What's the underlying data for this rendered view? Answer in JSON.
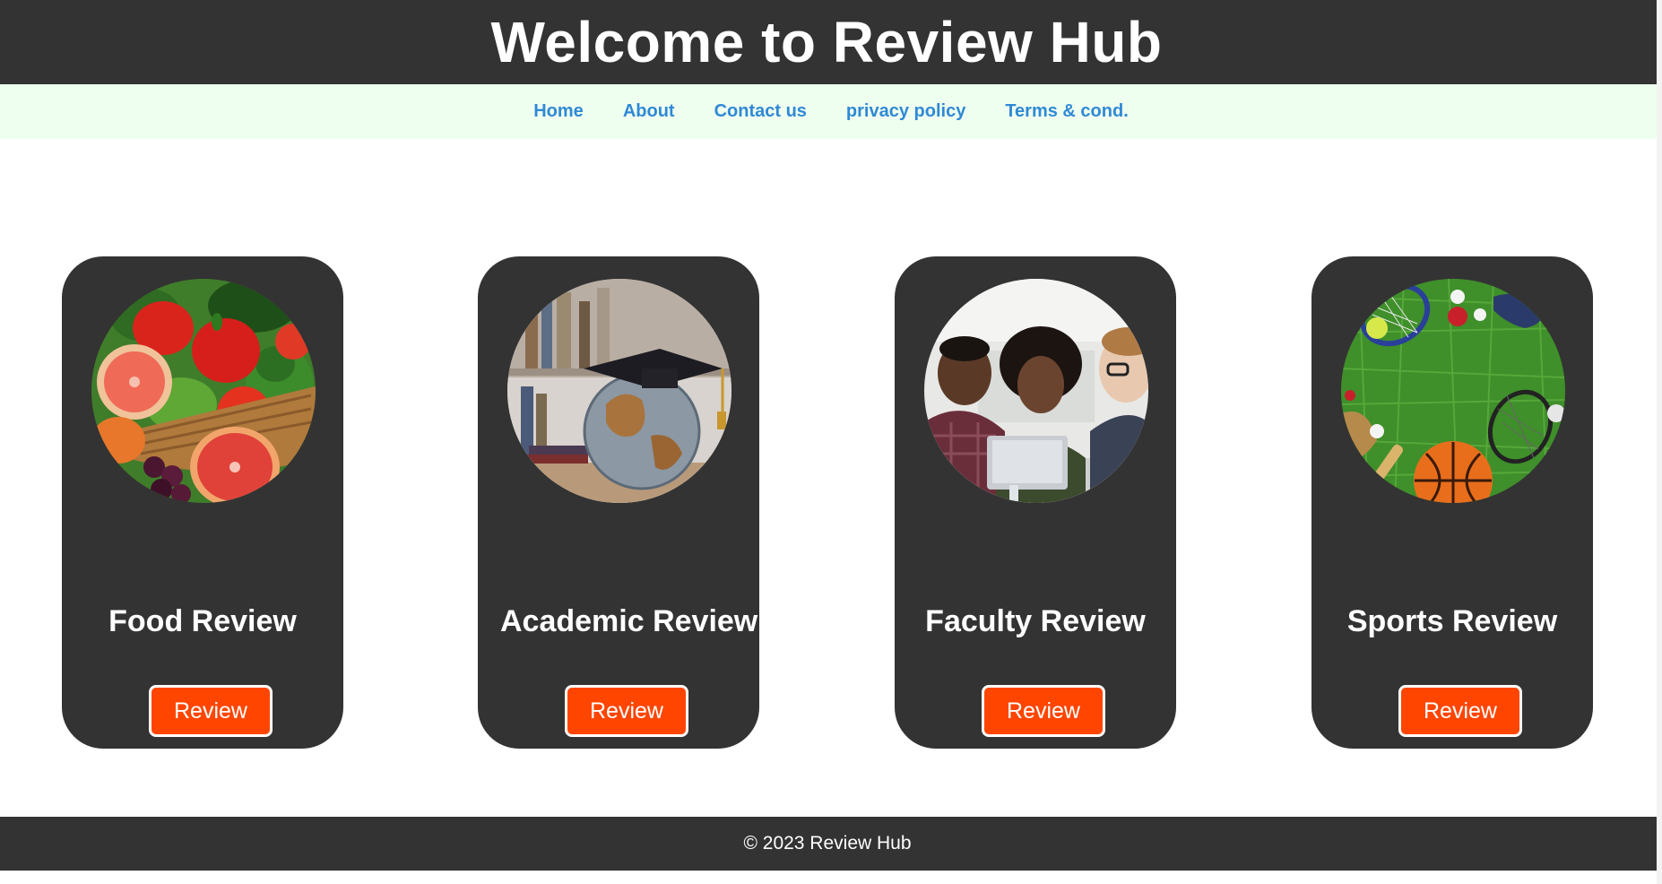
{
  "header": {
    "title": "Welcome to Review Hub"
  },
  "nav": {
    "items": [
      {
        "label": "Home"
      },
      {
        "label": "About"
      },
      {
        "label": "Contact us"
      },
      {
        "label": "privacy policy"
      },
      {
        "label": "Terms & cond."
      }
    ]
  },
  "cards": [
    {
      "title": "Food Review",
      "button": "Review",
      "image": "vegetables-basket-image"
    },
    {
      "title": "Academic Review",
      "button": "Review",
      "image": "graduation-globe-image"
    },
    {
      "title": "Faculty Review",
      "button": "Review",
      "image": "faculty-group-image"
    },
    {
      "title": "Sports Review",
      "button": "Review",
      "image": "sports-equipment-image"
    }
  ],
  "footer": {
    "text": "© 2023 Review Hub"
  },
  "colors": {
    "dark": "#333333",
    "nav_bg": "#efffef",
    "link": "#2f89d6",
    "button": "#ff4500"
  }
}
